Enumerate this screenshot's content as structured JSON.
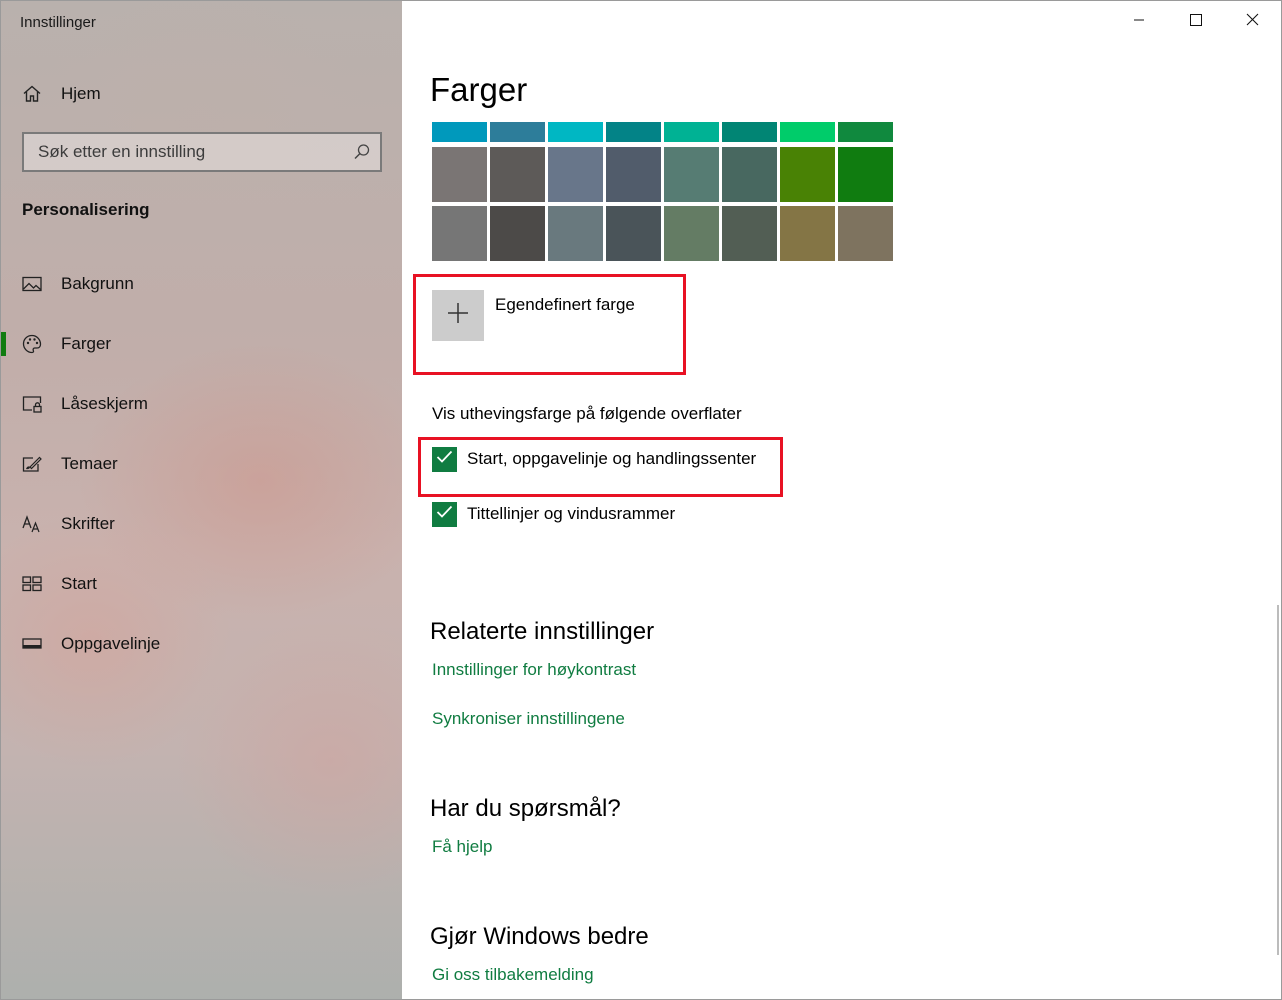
{
  "window": {
    "title": "Innstillinger",
    "controls": {
      "minimize": "minimize",
      "maximize": "maximize",
      "close": "close"
    }
  },
  "sidebar": {
    "home_label": "Hjem",
    "search_placeholder": "Søk etter en innstilling",
    "section_label": "Personalisering",
    "items": [
      {
        "label": "Bakgrunn",
        "icon": "picture-icon"
      },
      {
        "label": "Farger",
        "icon": "palette-icon",
        "active": true
      },
      {
        "label": "Låseskjerm",
        "icon": "lock-screen-icon"
      },
      {
        "label": "Temaer",
        "icon": "themes-brush-icon"
      },
      {
        "label": "Skrifter",
        "icon": "fonts-icon"
      },
      {
        "label": "Start",
        "icon": "start-grid-icon"
      },
      {
        "label": "Oppgavelinje",
        "icon": "taskbar-icon"
      }
    ]
  },
  "main": {
    "title": "Farger",
    "swatch_rows": [
      [
        "#0099bc",
        "#2d7d9a",
        "#00b7c3",
        "#038387",
        "#00b294",
        "#018574",
        "#00cc6a",
        "#10893e"
      ],
      [
        "#7a7574",
        "#5d5a58",
        "#68768a",
        "#515c6b",
        "#567c73",
        "#486860",
        "#498205",
        "#107c10"
      ],
      [
        "#767676",
        "#4c4a48",
        "#69797e",
        "#4a5459",
        "#647c64",
        "#525e54",
        "#847545",
        "#7e735f"
      ]
    ],
    "custom_color_label": "Egendefinert farge",
    "surfaces_label": "Vis uthevingsfarge på følgende overflater",
    "checkboxes": [
      {
        "label": "Start, oppgavelinje og handlingssenter",
        "checked": true
      },
      {
        "label": "Tittellinjer og vindusrammer",
        "checked": true
      }
    ],
    "related": {
      "heading": "Relaterte innstillinger",
      "links": [
        "Innstillinger for høykontrast",
        "Synkroniser innstillingene"
      ]
    },
    "questions": {
      "heading": "Har du spørsmål?",
      "link": "Få hjelp"
    },
    "feedback": {
      "heading": "Gjør Windows bedre",
      "link": "Gi oss tilbakemelding"
    }
  },
  "colors": {
    "accent": "#107c41",
    "highlight_box": "#e81123"
  }
}
